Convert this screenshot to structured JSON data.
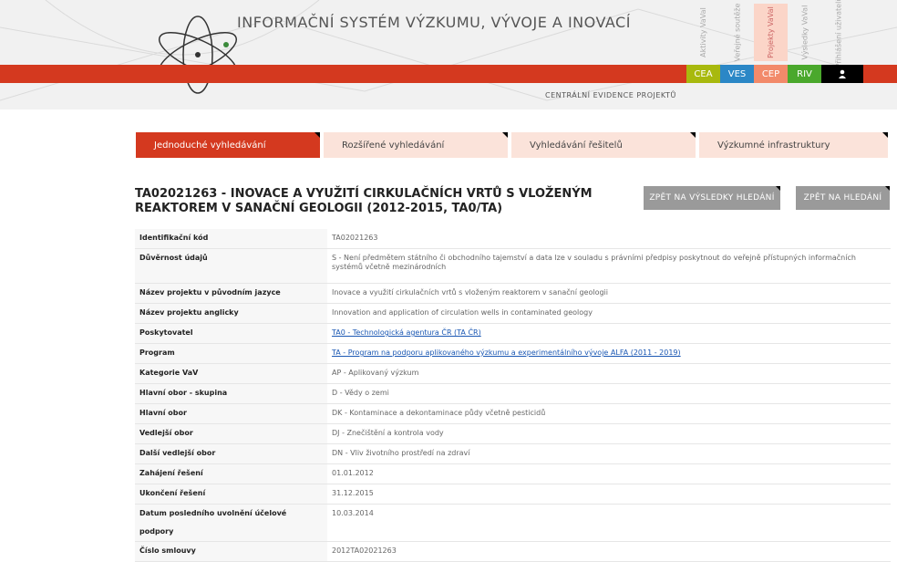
{
  "header": {
    "site_title": "INFORMAČNÍ SYSTÉM VÝZKUMU, VÝVOJE A INOVACÍ",
    "subtitle": "CENTRÁLNÍ EVIDENCE PROJEKTŮ",
    "top_tabs": [
      {
        "label": "Aktivity VaVaI",
        "active": false
      },
      {
        "label": "Veřejné soutěže",
        "active": false
      },
      {
        "label": "Projekty VaVaI",
        "active": true
      },
      {
        "label": "Výsledky VaVaI",
        "active": false
      },
      {
        "label": "Přihlášení uživatelů",
        "active": false
      }
    ],
    "system_tabs": [
      {
        "label": "CEA",
        "color": "#a8b90e"
      },
      {
        "label": "VES",
        "color": "#2b87c6"
      },
      {
        "label": "CEP",
        "color": "#f28a6a"
      },
      {
        "label": "RIV",
        "color": "#4aa82c"
      }
    ],
    "user_icon": "user-icon"
  },
  "search_tabs": [
    {
      "label": "Jednoduché vyhledávání",
      "active": true
    },
    {
      "label": "Rozšířené vyhledávání",
      "active": false
    },
    {
      "label": "Vyhledávání řešitelů",
      "active": false
    },
    {
      "label": "Výzkumné infrastruktury",
      "active": false
    }
  ],
  "project": {
    "title": "TA02021263 - INOVACE A VYUŽITÍ CIRKULAČNÍCH VRTŮ S VLOŽENÝM REAKTOREM V SANAČNÍ GEOLOGII (2012-2015, TA0/TA)"
  },
  "buttons": {
    "back_results": "ZPĚT NA VÝSLEDKY HLEDÁNÍ",
    "back_search": "ZPĚT NA HLEDÁNÍ"
  },
  "details": [
    {
      "label": "Identifikační kód",
      "value": "TA02021263"
    },
    {
      "label": "Důvěrnost údajů",
      "value": "S - Není předmětem státního či obchodního tajemství a data lze v souladu s právními předpisy poskytnout do veřejně přístupných informačních systémů včetně mezinárodních"
    },
    {
      "label": "Název projektu v původním jazyce",
      "value": "Inovace a využití cirkulačních vrtů s vloženým reaktorem v sanační geologii"
    },
    {
      "label": "Název projektu anglicky",
      "value": "Innovation and application of circulation wells in contaminated geology"
    },
    {
      "label": "Poskytovatel",
      "value": "TA0 - Technologická agentura ČR (TA ČR)"
    },
    {
      "label": "Program",
      "value": "TA - Program na podporu aplikovaného výzkumu a experimentálního vývoje ALFA (2011 - 2019)"
    },
    {
      "label": "Kategorie VaV",
      "value": "AP - Aplikovaný výzkum"
    },
    {
      "label": "Hlavní obor - skupina",
      "value": "D - Vědy o zemi"
    },
    {
      "label": "Hlavní obor",
      "value": "DK - Kontaminace a dekontaminace půdy včetně pesticidů"
    },
    {
      "label": "Vedlejší obor",
      "value": "DJ - Znečištění a kontrola vody"
    },
    {
      "label": "Další vedlejší obor",
      "value": "DN - Vliv životního prostředí na zdraví"
    },
    {
      "label": "Zahájení řešení",
      "value": "01.01.2012"
    },
    {
      "label": "Ukončení řešení",
      "value": "31.12.2015"
    },
    {
      "label": "Datum posledního uvolnění účelové podpory",
      "value": "10.03.2014"
    },
    {
      "label": "Číslo smlouvy",
      "value": "2012TA02021263"
    }
  ]
}
